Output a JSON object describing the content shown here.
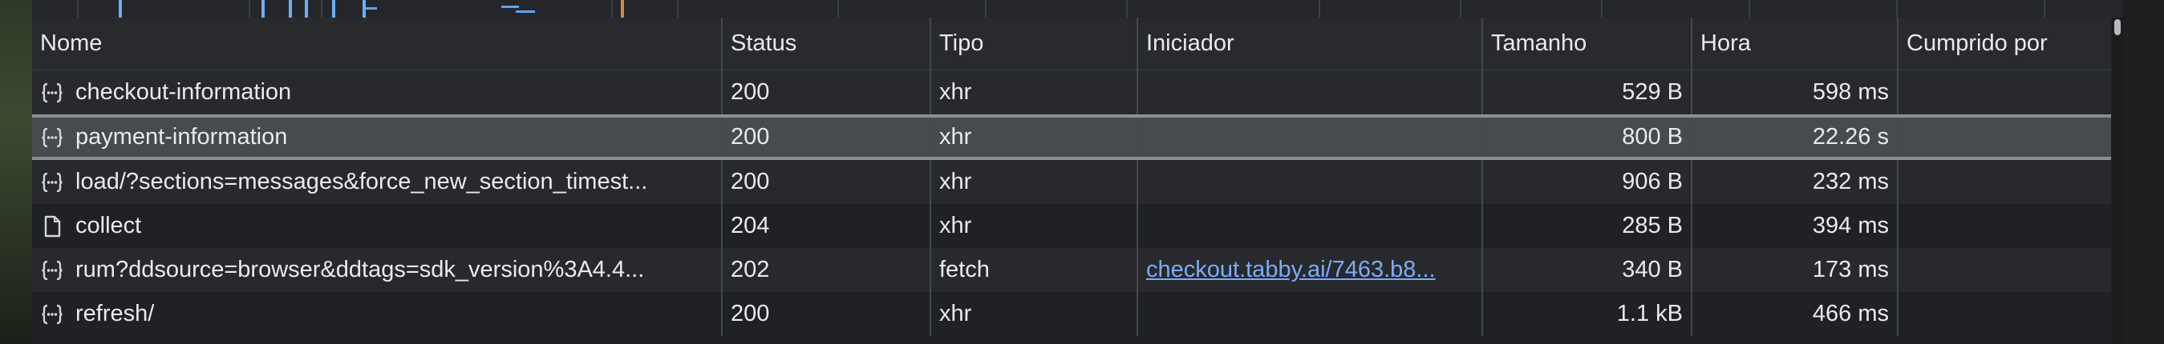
{
  "columns": {
    "name": "Nome",
    "status": "Status",
    "type": "Tipo",
    "initiator": "Iniciador",
    "size": "Tamanho",
    "time": "Hora",
    "served_by": "Cumprido por"
  },
  "rows": [
    {
      "icon": "xhr-braces-icon",
      "name": "checkout-information",
      "status": "200",
      "type": "xhr",
      "initiator": "",
      "size": "529 B",
      "time": "598 ms",
      "served_by": "",
      "selected": false
    },
    {
      "icon": "xhr-braces-icon",
      "name": "payment-information",
      "status": "200",
      "type": "xhr",
      "initiator": "",
      "size": "800 B",
      "time": "22.26 s",
      "served_by": "",
      "selected": true
    },
    {
      "icon": "xhr-braces-icon",
      "name": "load/?sections=messages&force_new_section_timest...",
      "status": "200",
      "type": "xhr",
      "initiator": "",
      "size": "906 B",
      "time": "232 ms",
      "served_by": "",
      "selected": false
    },
    {
      "icon": "document-icon",
      "name": "collect",
      "status": "204",
      "type": "xhr",
      "initiator": "",
      "size": "285 B",
      "time": "394 ms",
      "served_by": "",
      "selected": false
    },
    {
      "icon": "xhr-braces-icon",
      "name": "rum?ddsource=browser&ddtags=sdk_version%3A4.4...",
      "status": "202",
      "type": "fetch",
      "initiator": "checkout.tabby.ai/7463.b8...",
      "size": "340 B",
      "time": "173 ms",
      "served_by": "",
      "selected": false
    },
    {
      "icon": "xhr-braces-icon",
      "name": "refresh/",
      "status": "200",
      "type": "xhr",
      "initiator": "",
      "size": "1.1 kB",
      "time": "466 ms",
      "served_by": "",
      "selected": false
    }
  ],
  "colors": {
    "background": "#202124",
    "selected_row": "#474a4e",
    "link": "#7cacf8",
    "text": "#e8eaed"
  }
}
